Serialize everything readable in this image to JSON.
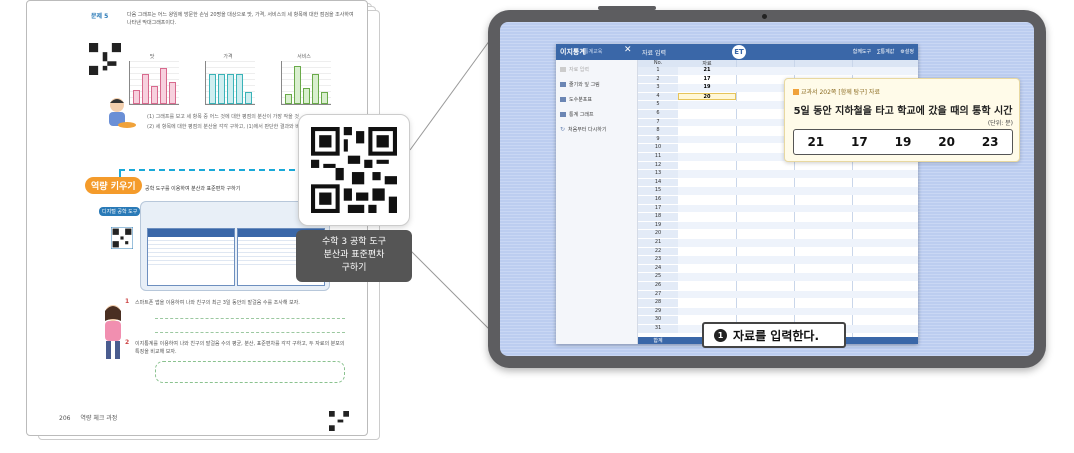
{
  "textbook": {
    "problem_label": "문제 5",
    "problem_text": "다음 그래프는 어느 왕임에 방문한 손님 20명을 대상으로 맛, 가격, 서비스의 세 항목에 대한 점검을 조사하여 나타낸 막대그래프이다.",
    "chart_captions": [
      "맛",
      "가격",
      "서비스"
    ],
    "sub_lines": [
      "(1) 그래프를 보고 세 항목 중 어느 것에 대한 평점의 분산이 가장 작을 것",
      "(2) 세 항목에 대한 평점의 분산을 각각 구하고, (1)에서 판단한 결과와 비교하"
    ],
    "skill_tag": "역량 키우기",
    "skill_title": "공학 도구를 이용하여 분산과 표준편차 구하기",
    "tool_label": "디지털 공학 도구",
    "q1": "스마트폰 앱을 이용하여 나와 친구의 최근 3일 동안의 발걸음 수를 조사해 보자.",
    "q2": "이지통계를 이용하여 나와 친구의 발걸음 수의 평균, 분산, 표준편차를 각각 구하고, 두 자료의 분포의 특징을 비교해 보자.",
    "page_number": "206",
    "footer_text": "역량 체크 과정"
  },
  "qr_caption": {
    "line1": "수학 3 공학 도구",
    "line2": "분산과 표준편차",
    "line3": "구하기"
  },
  "app": {
    "title": "이지통계",
    "subtitle": "통계교육",
    "tab": "자료 입력",
    "logo": "ET",
    "tools": [
      "함께도구",
      "∑통계값",
      "⚙설정"
    ],
    "sidebar": [
      {
        "label": "자료 입력",
        "muted": true
      },
      {
        "label": "줄기와 잎 그림",
        "muted": false
      },
      {
        "label": "도수분포표",
        "muted": false
      },
      {
        "label": "통계 그래프",
        "muted": false
      },
      {
        "label": "처음부터 다시하기",
        "muted": false
      }
    ],
    "grid_headers": {
      "no": "No.",
      "data": "자료"
    },
    "rows": [
      {
        "n": "1",
        "v": "21"
      },
      {
        "n": "2",
        "v": "17"
      },
      {
        "n": "3",
        "v": "19"
      },
      {
        "n": "4",
        "v": "20"
      },
      {
        "n": "5",
        "v": ""
      },
      {
        "n": "6",
        "v": ""
      },
      {
        "n": "7",
        "v": ""
      },
      {
        "n": "8",
        "v": ""
      },
      {
        "n": "9",
        "v": ""
      },
      {
        "n": "10",
        "v": ""
      },
      {
        "n": "11",
        "v": ""
      },
      {
        "n": "12",
        "v": ""
      },
      {
        "n": "13",
        "v": ""
      },
      {
        "n": "14",
        "v": ""
      },
      {
        "n": "15",
        "v": ""
      },
      {
        "n": "16",
        "v": ""
      },
      {
        "n": "17",
        "v": ""
      },
      {
        "n": "18",
        "v": ""
      },
      {
        "n": "19",
        "v": ""
      },
      {
        "n": "20",
        "v": ""
      },
      {
        "n": "21",
        "v": ""
      },
      {
        "n": "22",
        "v": ""
      },
      {
        "n": "23",
        "v": ""
      },
      {
        "n": "24",
        "v": ""
      },
      {
        "n": "25",
        "v": ""
      },
      {
        "n": "26",
        "v": ""
      },
      {
        "n": "27",
        "v": ""
      },
      {
        "n": "28",
        "v": ""
      },
      {
        "n": "29",
        "v": ""
      },
      {
        "n": "30",
        "v": ""
      },
      {
        "n": "31",
        "v": ""
      }
    ],
    "total_label": "합계"
  },
  "data_card": {
    "tag": "교과서 202쪽 [함께 탐구] 자료",
    "title": "5일 동안 지하철을 타고 학교에 갔을 때의 통학 시간",
    "unit": "(단위: 분)",
    "values": [
      "21",
      "17",
      "19",
      "20",
      "23"
    ]
  },
  "step_badge": {
    "num": "1",
    "text": "자료를 입력한다."
  }
}
